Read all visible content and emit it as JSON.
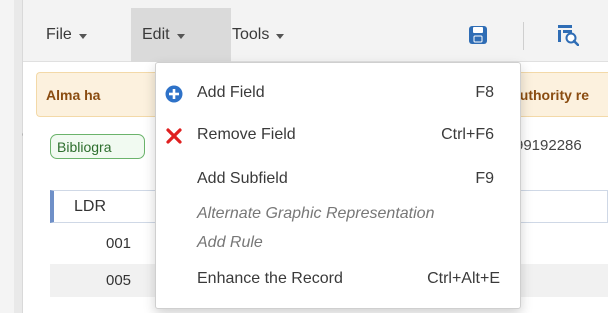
{
  "menubar": {
    "file_label": "File",
    "edit_label": "Edit",
    "tools_label": "Tools",
    "save_icon": "save-icon",
    "search_record_icon": "search-record-icon",
    "edit_active_bg": "#dadada"
  },
  "alert": {
    "text_left": "Alma ha",
    "text_right": "authority re",
    "bg_color": "#fcf1de",
    "text_color": "#8a4c10"
  },
  "record": {
    "badge_label": "Bibliogra",
    "record_id": "(99192286"
  },
  "marc": {
    "header_label": "LDR",
    "rows": [
      {
        "tag": "001"
      },
      {
        "tag": "005"
      }
    ]
  },
  "edit_menu": {
    "items": [
      {
        "label": "Add Field",
        "shortcut": "F8",
        "icon": "plus-circle-icon",
        "icon_color": "#2e72c8"
      },
      {
        "label": "Remove Field",
        "shortcut": "Ctrl+F6",
        "icon": "red-x-icon",
        "icon_color": "#e02020"
      },
      {
        "label": "Add Subfield",
        "shortcut": "F9"
      },
      {
        "label": "Alternate Graphic Representation",
        "disabled": true
      },
      {
        "label": "Add Rule",
        "disabled": true
      },
      {
        "label": "Enhance the Record",
        "shortcut": "Ctrl+Alt+E"
      }
    ]
  }
}
